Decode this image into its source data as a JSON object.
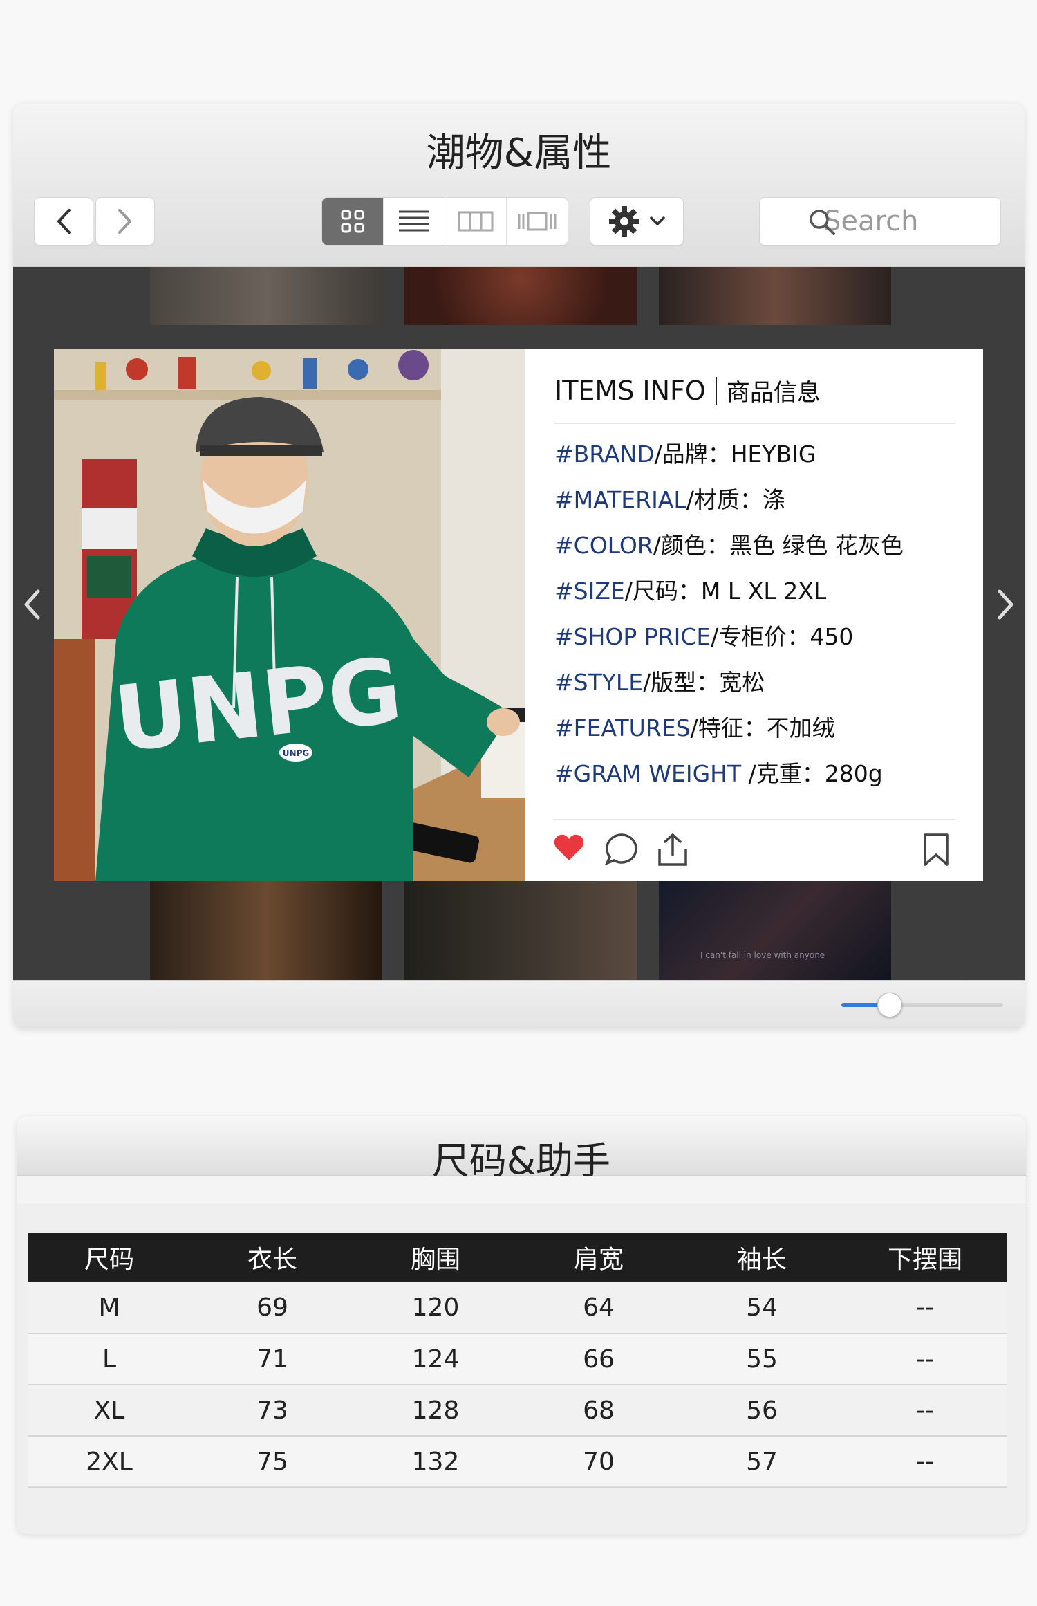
{
  "window1": {
    "title": "潮物&属性",
    "search_placeholder": "Search",
    "view_modes": [
      "grid-view",
      "list-view",
      "column-view",
      "cover-flow-view"
    ],
    "active_view": "grid-view"
  },
  "card": {
    "header_en": "ITEMS INFO",
    "header_zh": "商品信息",
    "rows": [
      {
        "key": "#BRAND",
        "label": "/品牌：",
        "value": "HEYBIG"
      },
      {
        "key": "#MATERIAL",
        "label": "/材质：",
        "value": "涤"
      },
      {
        "key": "#COLOR",
        "label": "/颜色：",
        "value": "黑色 绿色 花灰色"
      },
      {
        "key": "#SIZE",
        "label": "/尺码：",
        "value": "M L XL 2XL"
      },
      {
        "key": "#SHOP PRICE",
        "label": "/专柜价：",
        "value": "450"
      },
      {
        "key": "#STYLE",
        "label": "/版型：",
        "value": "宽松"
      },
      {
        "key": "#FEATURES",
        "label": "/特征：",
        "value": "不加绒"
      },
      {
        "key": "#GRAM WEIGHT ",
        "label": "/克重：",
        "value": "280g"
      }
    ],
    "photo": {
      "hoodie_text": "UNPG",
      "badge_text": "UNPG"
    },
    "colors": {
      "key": "#1f3a7a",
      "heart": "#e8373f",
      "hoodie": "#0f7a5a"
    }
  },
  "thumb_caption": "I can't fall in love with anyone",
  "zoom_slider": {
    "value": 0.3,
    "accent": "#2f7de1"
  },
  "window2": {
    "title": "尺码&助手",
    "table": {
      "headers": [
        "尺码",
        "衣长",
        "胸围",
        "肩宽",
        "袖长",
        "下摆围"
      ],
      "rows": [
        [
          "M",
          "69",
          "120",
          "64",
          "54",
          "--"
        ],
        [
          "L",
          "71",
          "124",
          "66",
          "55",
          "--"
        ],
        [
          "XL",
          "73",
          "128",
          "68",
          "56",
          "--"
        ],
        [
          "2XL",
          "75",
          "132",
          "70",
          "57",
          "--"
        ]
      ]
    }
  }
}
